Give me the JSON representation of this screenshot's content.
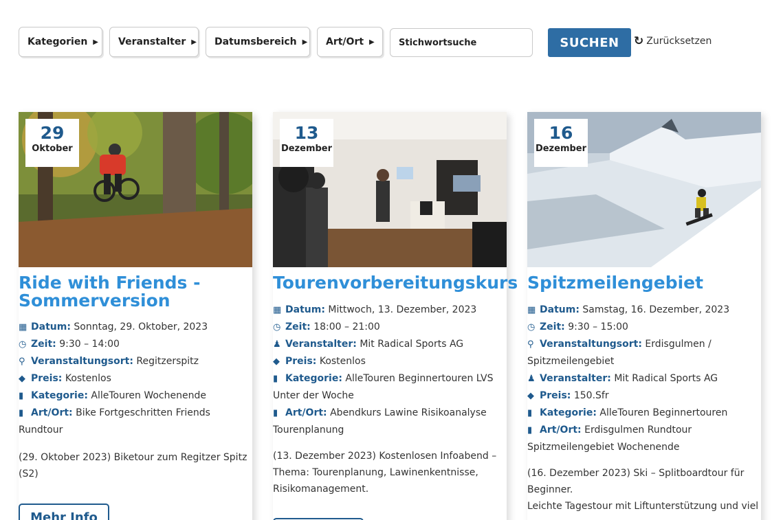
{
  "filters": {
    "kategorien": "Kategorien",
    "veranstalter": "Veranstalter",
    "datumsbereich": "Datumsbereich",
    "art_ort": "Art/Ort",
    "search_placeholder": "Stichwortsuche",
    "search_button": "SUCHEN",
    "reset": "Zurücksetzen"
  },
  "labels": {
    "datum": "Datum:",
    "zeit": "Zeit:",
    "veranstalter": "Veranstalter:",
    "veranstaltungsort": "Veranstaltungsort:",
    "preis": "Preis:",
    "kategorie": "Kategorie:",
    "art_ort": "Art/Ort:",
    "more_info": "Mehr Info"
  },
  "events": [
    {
      "day": "29",
      "month": "Oktober",
      "title": "Ride with Friends - Sommerversion",
      "datum": "Sonntag, 29. Oktober, 2023",
      "zeit": "9:30 – 14:00",
      "veranstaltungsort": "Regitzerspitz",
      "preis": "Kostenlos",
      "kategorie": "AlleTouren Wochenende",
      "art_ort": "Bike Fortgeschritten Friends Rundtour",
      "description": "(29. Oktober 2023) Biketour zum Regitzer Spitz (S2)"
    },
    {
      "day": "13",
      "month": "Dezember",
      "title": "Tourenvorbereitungskurs",
      "datum": "Mittwoch, 13. Dezember, 2023",
      "zeit": "18:00 – 21:00",
      "veranstalter": "Mit Radical Sports AG",
      "preis": "Kostenlos",
      "kategorie": "AlleTouren Beginnertouren LVS Unter der Woche",
      "art_ort": "Abendkurs Lawine Risikoanalyse Tourenplanung",
      "description": "(13. Dezember 2023) Kostenlosen Infoabend – Thema: Tourenplanung, Lawinenkentnisse, Risikomanagement."
    },
    {
      "day": "16",
      "month": "Dezember",
      "title": "Spitzmeilengebiet",
      "datum": "Samstag, 16. Dezember, 2023",
      "zeit": "9:30 – 15:00",
      "veranstaltungsort": "Erdisgulmen / Spitzmeilengebiet",
      "veranstalter": "Mit Radical Sports AG",
      "preis": "150.Sfr",
      "kategorie": "AlleTouren Beginnertouren",
      "art_ort": "Erdisgulmen Rundtour Spitzmeilengebiet Wochenende",
      "description": "(16. Dezember 2023) Ski – Splitboardtour für Beginner.",
      "description2": "Leichte Tagestour mit Liftunterstützung und viel"
    }
  ]
}
